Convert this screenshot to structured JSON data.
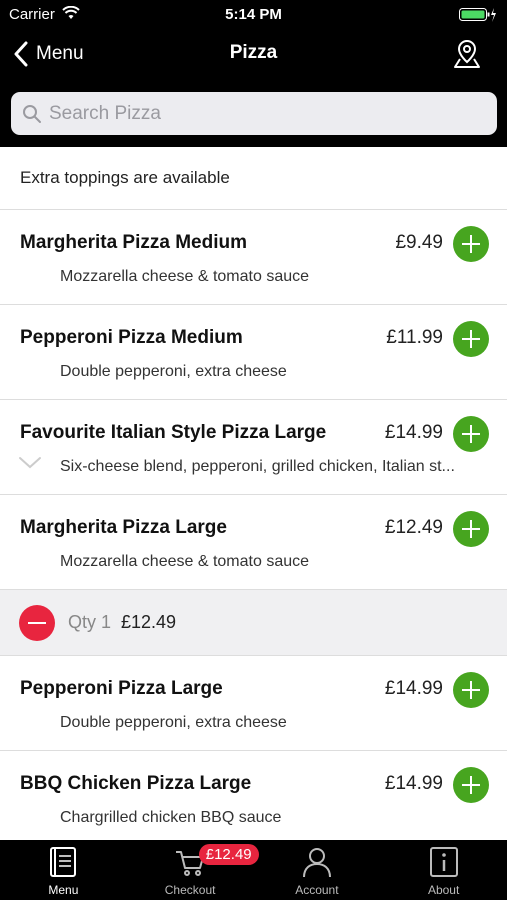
{
  "status_bar": {
    "carrier": "Carrier",
    "time": "5:14 PM"
  },
  "nav": {
    "back_label": "Menu",
    "title": "Pizza"
  },
  "search": {
    "placeholder": "Search Pizza"
  },
  "info": "Extra toppings are available",
  "items": [
    {
      "name": "Margherita Pizza Medium",
      "price": "£9.49",
      "description": "Mozzarella cheese & tomato sauce"
    },
    {
      "name": "Pepperoni Pizza Medium",
      "price": "£11.99",
      "description": "Double pepperoni, extra cheese"
    },
    {
      "name": "Favourite Italian Style Pizza Large",
      "price": "£14.99",
      "description": "Six-cheese blend, pepperoni, grilled chicken, Italian st..."
    },
    {
      "name": "Margherita Pizza Large",
      "price": "£12.49",
      "description": "Mozzarella cheese & tomato sauce"
    },
    {
      "name": "Pepperoni Pizza Large",
      "price": "£14.99",
      "description": "Double pepperoni, extra cheese"
    },
    {
      "name": "BBQ Chicken Pizza Large",
      "price": "£14.99",
      "description": "Chargrilled chicken BBQ sauce"
    }
  ],
  "qty_row": {
    "qty": "Qty 1",
    "price": "£12.49"
  },
  "tabs": [
    {
      "label": "Menu",
      "icon": "menu-book-icon"
    },
    {
      "label": "Checkout",
      "icon": "cart-icon",
      "badge": "£12.49"
    },
    {
      "label": "Account",
      "icon": "person-icon"
    },
    {
      "label": "About",
      "icon": "info-icon"
    }
  ],
  "colors": {
    "add": "#47a51f",
    "remove": "#e8253f",
    "bar": "#000000"
  }
}
